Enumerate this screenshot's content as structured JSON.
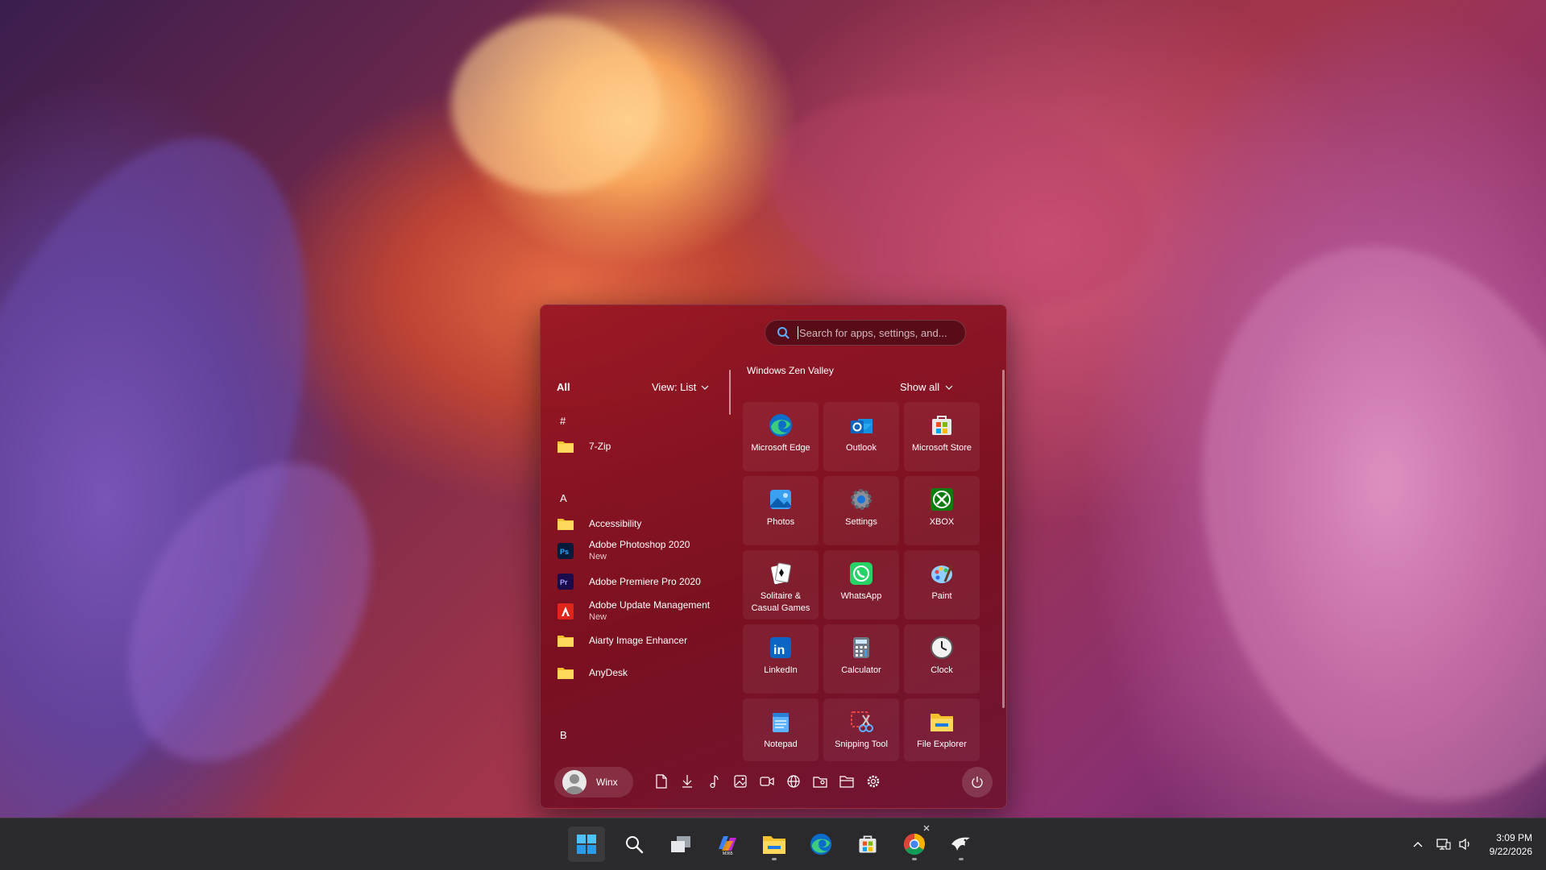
{
  "start_menu": {
    "search": {
      "placeholder": "Search for apps, settings, and..."
    },
    "all_apps": {
      "heading": "All",
      "view_label": "View: List",
      "letters": [
        "#",
        "A",
        "B"
      ],
      "items": [
        {
          "label": "7-Zip",
          "sub": "",
          "icon": "folder-icon"
        },
        {
          "label": "Accessibility",
          "sub": "",
          "icon": "folder-icon"
        },
        {
          "label": "Adobe Photoshop 2020",
          "sub": "New",
          "icon": "photoshop-icon"
        },
        {
          "label": "Adobe Premiere Pro 2020",
          "sub": "",
          "icon": "premiere-icon"
        },
        {
          "label": "Adobe Update Management",
          "sub": "New",
          "icon": "adobe-icon"
        },
        {
          "label": "Aiarty Image Enhancer",
          "sub": "",
          "icon": "folder-icon"
        },
        {
          "label": "AnyDesk",
          "sub": "",
          "icon": "folder-icon"
        }
      ]
    },
    "pinned": {
      "group_title": "Windows Zen Valley",
      "show_all": "Show all",
      "tiles": [
        {
          "label": "Microsoft Edge",
          "icon": "edge-icon"
        },
        {
          "label": "Outlook",
          "icon": "outlook-icon"
        },
        {
          "label": "Microsoft Store",
          "icon": "store-icon"
        },
        {
          "label": "Photos",
          "icon": "photos-icon"
        },
        {
          "label": "Settings",
          "icon": "settings-icon"
        },
        {
          "label": "XBOX",
          "icon": "xbox-icon"
        },
        {
          "label": "Solitaire & Casual Games",
          "icon": "solitaire-icon"
        },
        {
          "label": "WhatsApp",
          "icon": "whatsapp-icon"
        },
        {
          "label": "Paint",
          "icon": "paint-icon"
        },
        {
          "label": "LinkedIn",
          "icon": "linkedin-icon"
        },
        {
          "label": "Calculator",
          "icon": "calculator-icon"
        },
        {
          "label": "Clock",
          "icon": "clock-icon"
        },
        {
          "label": "Notepad",
          "icon": "notepad-icon"
        },
        {
          "label": "Snipping Tool",
          "icon": "snipping-tool-icon"
        },
        {
          "label": "File Explorer",
          "icon": "file-explorer-icon"
        }
      ]
    },
    "user": {
      "name": "Winx"
    },
    "quick_links": [
      "documents-icon",
      "downloads-icon",
      "music-icon",
      "pictures-icon",
      "videos-icon",
      "network-icon",
      "personal-folder-icon",
      "file-explorer-icon",
      "settings-icon"
    ],
    "power": "power-icon"
  },
  "taskbar": {
    "apps": [
      "start-icon",
      "search-icon",
      "task-view-icon",
      "m365-copilot-icon",
      "file-explorer-icon",
      "edge-icon",
      "microsoft-store-icon",
      "chrome-icon",
      "app-icon"
    ],
    "clock": {
      "time": "3:09 PM",
      "date": "9/22/2026"
    }
  },
  "colors": {
    "menu_bg": "#8a1422",
    "taskbar_bg": "#2a2a2c",
    "accent": "#0f7be0"
  }
}
